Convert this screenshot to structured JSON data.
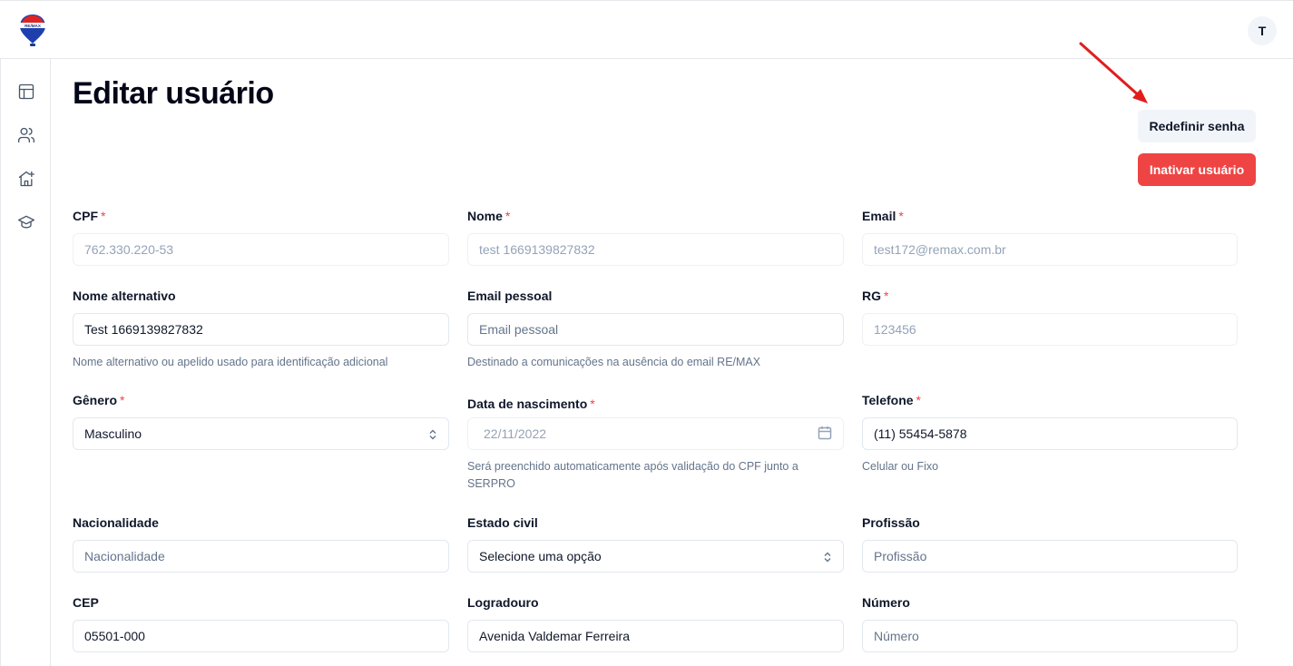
{
  "header": {
    "logo_icon": "remax-balloon-logo",
    "avatar_initial": "T"
  },
  "sidebar": {
    "items": [
      {
        "icon": "layout-icon"
      },
      {
        "icon": "users-icon"
      },
      {
        "icon": "house-plus-icon"
      },
      {
        "icon": "graduation-cap-icon"
      }
    ]
  },
  "page": {
    "title": "Editar usuário"
  },
  "actions": {
    "reset_password": "Redefinir senha",
    "inactivate_user": "Inativar usuário"
  },
  "required_mark": "*",
  "form": {
    "cpf": {
      "label": "CPF",
      "value": "762.330.220-53"
    },
    "nome": {
      "label": "Nome",
      "value": "test 1669139827832"
    },
    "email": {
      "label": "Email",
      "value": "test172@remax.com.br"
    },
    "nome_alternativo": {
      "label": "Nome alternativo",
      "value": "Test 1669139827832",
      "help": "Nome alternativo ou apelido usado para identificação adicional"
    },
    "email_pessoal": {
      "label": "Email pessoal",
      "placeholder": "Email pessoal",
      "help": "Destinado a comunicações na ausência do email RE/MAX"
    },
    "rg": {
      "label": "RG",
      "value": "123456"
    },
    "genero": {
      "label": "Gênero",
      "value": "Masculino"
    },
    "data_nascimento": {
      "label": "Data de nascimento",
      "value": "22/11/2022",
      "help": "Será preenchido automaticamente após validação do CPF junto a SERPRO"
    },
    "telefone": {
      "label": "Telefone",
      "value": "(11) 55454-5878",
      "help": "Celular ou Fixo"
    },
    "nacionalidade": {
      "label": "Nacionalidade",
      "placeholder": "Nacionalidade"
    },
    "estado_civil": {
      "label": "Estado civil",
      "value": "Selecione uma opção"
    },
    "profissao": {
      "label": "Profissão",
      "placeholder": "Profissão"
    },
    "cep": {
      "label": "CEP",
      "value": "05501-000"
    },
    "logradouro": {
      "label": "Logradouro",
      "value": "Avenida Valdemar Ferreira"
    },
    "numero": {
      "label": "Número",
      "placeholder": "Número"
    }
  },
  "colors": {
    "danger": "#ef4444",
    "secondary": "#f1f5f9",
    "annotation_arrow": "#e11d1d"
  }
}
